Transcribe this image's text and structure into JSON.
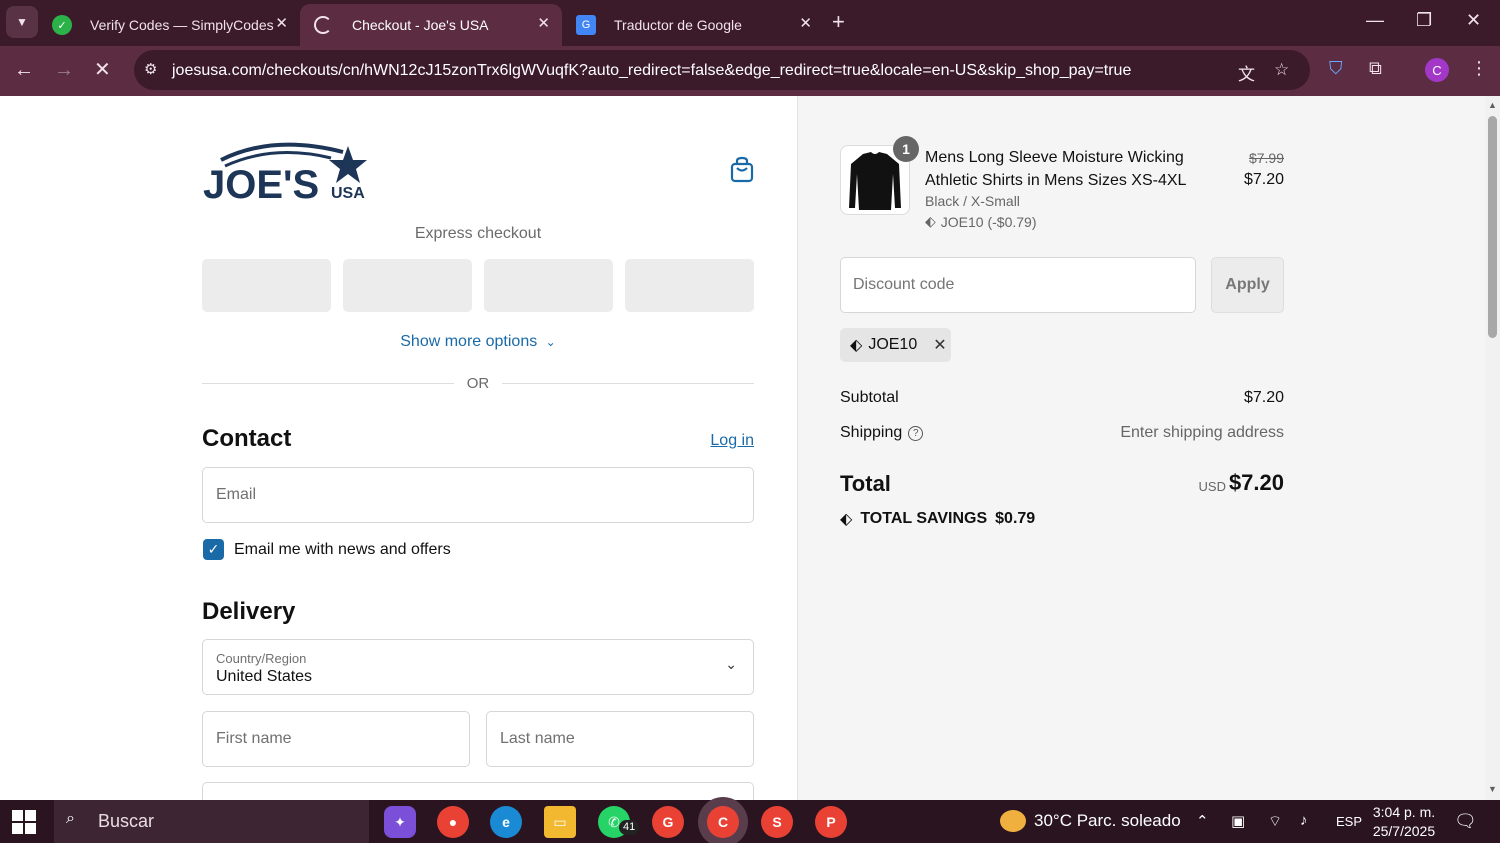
{
  "browser": {
    "tabs": [
      {
        "title": "Verify Codes — SimplyCodes",
        "favicon": "simplycodes-icon"
      },
      {
        "title": "Checkout - Joe's USA",
        "favicon": "loading-spinner-icon"
      },
      {
        "title": "Traductor de Google",
        "favicon": "google-translate-icon"
      }
    ],
    "url": "joesusa.com/checkouts/cn/hWN12cJ15zonTrx6lgWVuqfK?auto_redirect=false&edge_redirect=true&locale=en-US&skip_shop_pay=true",
    "profile_initial": "C"
  },
  "checkout": {
    "logo_text": "JOE'S",
    "logo_sub": "USA",
    "express_label": "Express checkout",
    "show_more": "Show more options",
    "or_label": "OR",
    "contact_title": "Contact",
    "login_link": "Log in",
    "email_placeholder": "Email",
    "newsletter_label": "Email me with news and offers",
    "newsletter_checked": true,
    "delivery_title": "Delivery",
    "country_label": "Country/Region",
    "country_value": "United States",
    "first_name_placeholder": "First name",
    "last_name_placeholder": "Last name"
  },
  "summary": {
    "quantity": "1",
    "product_name": "Mens Long Sleeve Moisture Wicking Athletic Shirts in Mens Sizes XS-4XL",
    "variant": "Black / X-Small",
    "item_discount": "JOE10 (-$0.79)",
    "price_original": "$7.99",
    "price_final": "$7.20",
    "discount_placeholder": "Discount code",
    "apply_label": "Apply",
    "applied_code": "JOE10",
    "subtotal_label": "Subtotal",
    "subtotal_value": "$7.20",
    "shipping_label": "Shipping",
    "shipping_value": "Enter shipping address",
    "total_label": "Total",
    "total_currency": "USD",
    "total_value": "$7.20",
    "savings_label": "TOTAL SAVINGS",
    "savings_value": "$0.79"
  },
  "taskbar": {
    "search_placeholder": "Buscar",
    "whatsapp_badge": "41",
    "weather": "30°C  Parc. soleado",
    "language": "ESP",
    "time": "3:04 p. m.",
    "date": "25/7/2025"
  },
  "colors": {
    "accent": "#1a6aa8",
    "browser_frame": "#3b1a2a",
    "browser_toolbar": "#5c2c42"
  }
}
